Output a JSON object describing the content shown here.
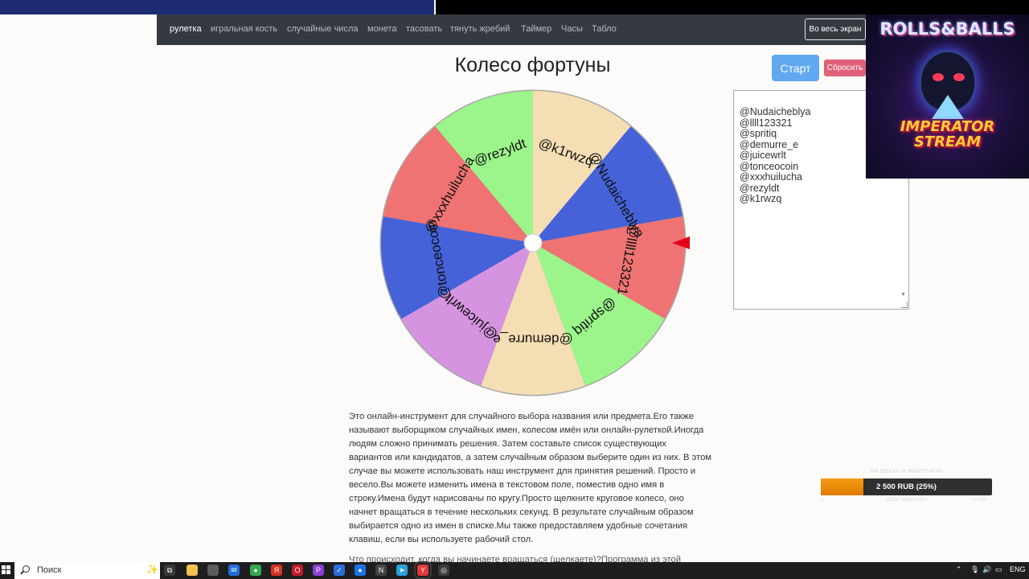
{
  "nav": {
    "items": [
      {
        "label": "рулетка",
        "active": true
      },
      {
        "label": "игральная кость"
      },
      {
        "label": "случайные числа"
      },
      {
        "label": "монета"
      },
      {
        "label": "тасовать"
      },
      {
        "label": "тянуть жребий"
      },
      {
        "label": "Таймер"
      },
      {
        "label": "Часы"
      },
      {
        "label": "Табло"
      }
    ],
    "fullscreen_label": "Во весь экран"
  },
  "page": {
    "title": "Колесо фортуны",
    "start_label": "Старт",
    "reset_label": "Сбросить"
  },
  "wheel": {
    "colors": {
      "green": "#9bf58a",
      "wheat": "#f5deb3",
      "blue": "#4562d8",
      "red": "#ef7373",
      "violet": "#d593e0",
      "pointer": "#e5001a",
      "rim": "#a8a8a8",
      "text": "#111111"
    },
    "segments": [
      {
        "label": "@k1rwzq",
        "color": "wheat"
      },
      {
        "label": "@Nudaicheblya",
        "color": "blue"
      },
      {
        "label": "@llll123321",
        "color": "red"
      },
      {
        "label": "@spritiq",
        "color": "green"
      },
      {
        "label": "@demurre_e",
        "color": "wheat"
      },
      {
        "label": "@juicewrlt",
        "color": "violet"
      },
      {
        "label": "@tonceocoin",
        "color": "blue"
      },
      {
        "label": "@xxxhuilucha",
        "color": "red"
      },
      {
        "label": "@rezyldt",
        "color": "green"
      }
    ]
  },
  "names": {
    "lines": [
      "@Nudaicheblya",
      "@llll123321",
      "@spritiq",
      "@demurre_e",
      "@juicewrlt",
      "@tonceocoin",
      "@xxxhuilucha",
      "@rezyldt",
      "@k1rwzq"
    ]
  },
  "overlay": {
    "logo_top": "ROLLS&BALLS",
    "logo_bottom_1": "IMPERATOR",
    "logo_bottom_2": "STREAM"
  },
  "description": {
    "p1": "Это онлайн-инструмент для случайного выбора названия или предмета.Его также называют выборщиком случайных имен, колесом имён или онлайн-рулеткой.Иногда людям сложно принимать решения. Затем составьте список существующих вариантов или кандидатов, а затем случайным образом выберите один из них. В этом случае вы можете использовать наш инструмент для принятия решений. Просто и весело.Вы можете изменить имена в текстовом поле, поместив одно имя в строку.Имена будут нарисованы по кругу.Просто щелкните круговое колесо, оно начнет вращаться в течение нескольких секунд. В результате случайным образом выбирается одно из имен в списке.Мы также предоставляем удобные сочетания клавиш, если вы используете рабочий стол.",
    "p2": "Что происходит, когда вы начинаете вращаться (щелкаете)?Программа из этой"
  },
  "donation": {
    "title": "НА ВЕБКУ И МИКРОФОН",
    "amount_text": "2 500 RUB (25%)",
    "progress": 0.25,
    "fill_color": "#f39c12",
    "min_label": "0",
    "status_label": "СБОР ЗАВЕРШЕН",
    "max_label": "10 000"
  },
  "taskbar": {
    "search_placeholder": "Поиск",
    "language": "ENG",
    "icons": [
      {
        "name": "task-view-icon",
        "color": "#3a3a3a",
        "glyph": "⧉"
      },
      {
        "name": "file-explorer-icon",
        "color": "#f2c14e",
        "glyph": ""
      },
      {
        "name": "store-icon",
        "color": "#5c5c5c",
        "glyph": ""
      },
      {
        "name": "mail-icon",
        "color": "#1f6fd6",
        "glyph": "✉"
      },
      {
        "name": "chrome-icon",
        "color": "#34a853",
        "glyph": "●"
      },
      {
        "name": "yandex-icon",
        "color": "#d93025",
        "glyph": "Я"
      },
      {
        "name": "opera-icon",
        "color": "#c21b2d",
        "glyph": "O"
      },
      {
        "name": "photo-icon",
        "color": "#8a3fd1",
        "glyph": "P"
      },
      {
        "name": "checkmark-app-icon",
        "color": "#2b6bde",
        "glyph": "✓"
      },
      {
        "name": "chrome-dev-icon",
        "color": "#1a73e8",
        "glyph": "●"
      },
      {
        "name": "notepad-icon",
        "color": "#444444",
        "glyph": "N"
      },
      {
        "name": "telegram-icon",
        "color": "#2aa1da",
        "glyph": "➤"
      },
      {
        "name": "yandex-browser-icon",
        "color": "#e03a3a",
        "glyph": "Y"
      },
      {
        "name": "obs-icon",
        "color": "#3c3c3c",
        "glyph": "◎"
      }
    ]
  }
}
